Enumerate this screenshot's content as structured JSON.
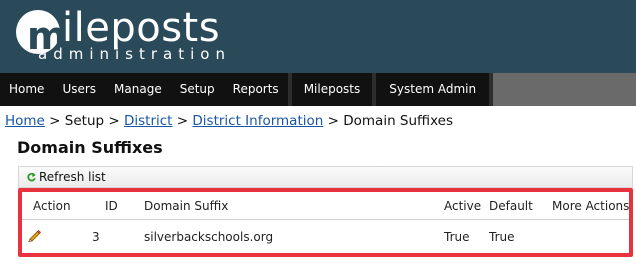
{
  "header": {
    "logo_m": "m",
    "logo_word": "ileposts",
    "logo_sub": "administration"
  },
  "nav": {
    "group1": [
      "Home",
      "Users",
      "Manage",
      "Setup",
      "Reports"
    ],
    "group2": [
      "Mileposts"
    ],
    "group3": [
      "System Admin"
    ]
  },
  "breadcrumb": {
    "home": "Home",
    "sep1": ">",
    "setup": "Setup",
    "sep2": ">",
    "district": "District",
    "sep3": ">",
    "district_info": "District Information",
    "sep4": ">",
    "current": "Domain Suffixes"
  },
  "page": {
    "title": "Domain Suffixes"
  },
  "toolbar": {
    "refresh_label": "Refresh list",
    "refresh_icon": "refresh-icon"
  },
  "table": {
    "headers": {
      "action": "Action",
      "id": "ID",
      "suffix": "Domain Suffix",
      "active": "Active",
      "default": "Default",
      "more": "More Actions"
    },
    "rows": [
      {
        "action_icon": "pencil-icon",
        "id": "3",
        "suffix": "silverbackschools.org",
        "active": "True",
        "default": "True",
        "more": ""
      }
    ]
  },
  "colors": {
    "banner": "#2a4a5a",
    "nav": "#111111",
    "link": "#1a56a6",
    "highlight_border": "#e8333f"
  }
}
